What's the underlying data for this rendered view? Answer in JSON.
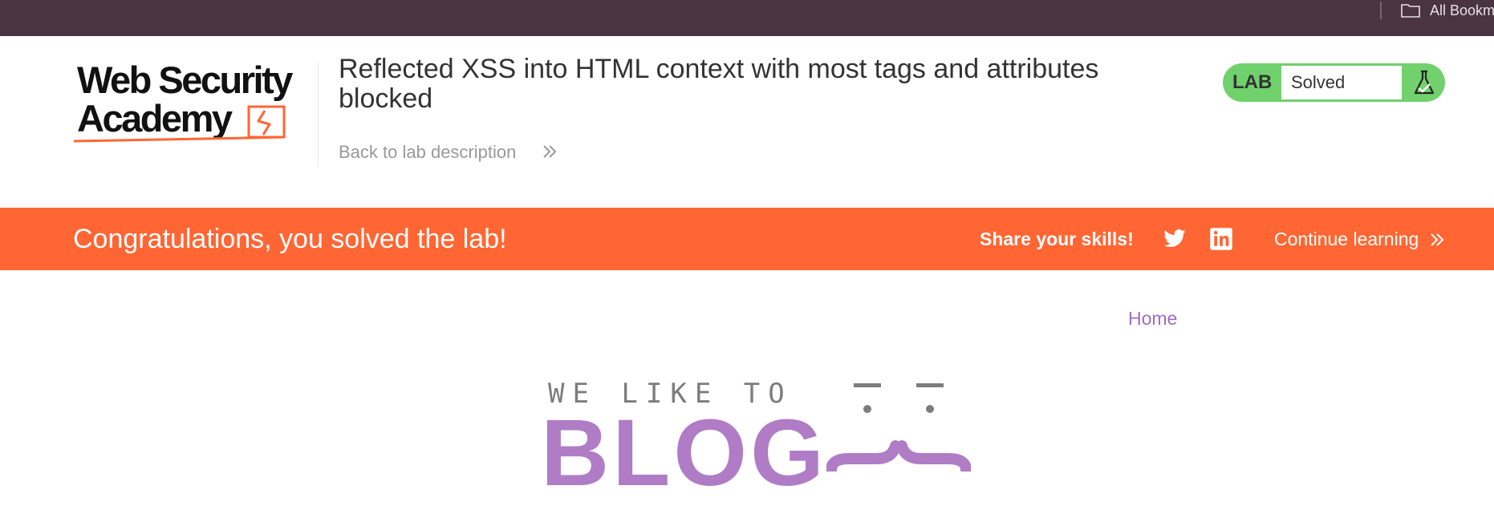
{
  "browser": {
    "bookmarks_label": "All Bookm"
  },
  "header": {
    "logo_line1": "Web Security",
    "logo_line2": "Academy",
    "lab_title": "Reflected XSS into HTML context with most tags and attributes blocked",
    "back_link": "Back to lab description",
    "lab_badge": "LAB",
    "lab_status": "Solved",
    "status_color": "#70d16d"
  },
  "banner": {
    "message": "Congratulations, you solved the lab!",
    "share_label": "Share your skills!",
    "continue_label": "Continue learning",
    "color": "#ff6633"
  },
  "blog": {
    "nav_home": "Home",
    "tagline": "WE LIKE TO",
    "word": "BLOG",
    "accent": "#b07cc6"
  }
}
